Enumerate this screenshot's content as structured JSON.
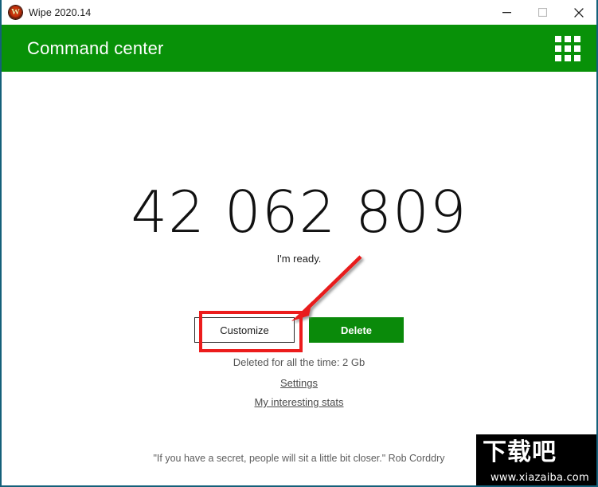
{
  "window": {
    "title": "Wipe 2020.14",
    "app_icon": "wipe-logo-icon",
    "controls": {
      "minimize": "minimize-icon",
      "maximize": "maximize-icon",
      "close": "close-icon"
    }
  },
  "header": {
    "title": "Command center",
    "menu_icon": "grid-menu-icon",
    "background_color": "#089108"
  },
  "main": {
    "counter": "42 062 809",
    "status": "I'm ready.",
    "customize_label": "Customize",
    "delete_label": "Delete",
    "deleted_total": "Deleted for all the time: 2 Gb",
    "settings_link": "Settings",
    "stats_link": "My interesting stats",
    "quote": "\"If you have a secret, people will sit a little bit closer.\" Rob Corddry"
  },
  "annotation": {
    "highlight_color": "#ec1c1c",
    "target": "Customize"
  },
  "watermark": {
    "logo_text": "下载吧",
    "url": "www.xiazaiba.com"
  }
}
